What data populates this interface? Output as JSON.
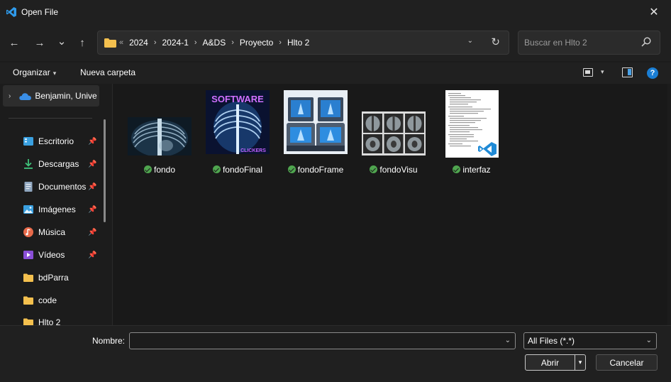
{
  "window": {
    "title": "Open File",
    "close_glyph": "✕"
  },
  "nav": {
    "back_glyph": "←",
    "forward_glyph": "→",
    "recent_glyph": "⌄",
    "up_glyph": "↑",
    "address_overflow": "«",
    "breadcrumb": [
      "2024",
      "2024-1",
      "A&DS",
      "Proyecto",
      "Hlto 2"
    ],
    "crumb_separator": "›",
    "dropdown_glyph": "⌄",
    "refresh_glyph": "↻",
    "search_placeholder": "Buscar en Hlto 2"
  },
  "toolbar": {
    "organize": "Organizar",
    "organize_caret": "▾",
    "new_folder": "Nueva carpeta",
    "view_caret": "▾",
    "help": "?"
  },
  "sidebar": {
    "onedrive": {
      "label": "Benjamin, Unive",
      "expand_glyph": "›"
    },
    "pin_glyph": "📌",
    "items": [
      {
        "label": "Escritorio",
        "icon": "desktop-icon",
        "pinned": true
      },
      {
        "label": "Descargas",
        "icon": "download-icon",
        "pinned": true
      },
      {
        "label": "Documentos",
        "icon": "documents-icon",
        "pinned": true
      },
      {
        "label": "Imágenes",
        "icon": "pictures-icon",
        "pinned": true
      },
      {
        "label": "Música",
        "icon": "music-icon",
        "pinned": true
      },
      {
        "label": "Vídeos",
        "icon": "videos-icon",
        "pinned": true
      },
      {
        "label": "bdParra",
        "icon": "folder-icon",
        "pinned": false
      },
      {
        "label": "code",
        "icon": "folder-icon",
        "pinned": false
      },
      {
        "label": "Hlto 2",
        "icon": "folder-icon",
        "pinned": false
      }
    ]
  },
  "files": [
    {
      "name": "fondo",
      "thumb": "xray-chest"
    },
    {
      "name": "fondoFinal",
      "thumb": "software-clickers-poster",
      "thumb_title": "SOFTWARE",
      "thumb_subtitle": "CLICKERS"
    },
    {
      "name": "fondoFrame",
      "thumb": "xray-machines"
    },
    {
      "name": "fondoVisu",
      "thumb": "xray-grid"
    },
    {
      "name": "interfaz",
      "thumb": "code-document-vscode"
    }
  ],
  "footer": {
    "name_label": "Nombre:",
    "name_value": "",
    "name_caret": "⌄",
    "filter_value": "All Files (*.*)",
    "filter_caret": "⌄",
    "open_button": "Abrir",
    "open_split_glyph": "▾",
    "cancel_button": "Cancelar"
  },
  "colors": {
    "accent": "#1a7ed4",
    "sync_ok": "#4fa54f",
    "folder": "#f4c04e"
  }
}
